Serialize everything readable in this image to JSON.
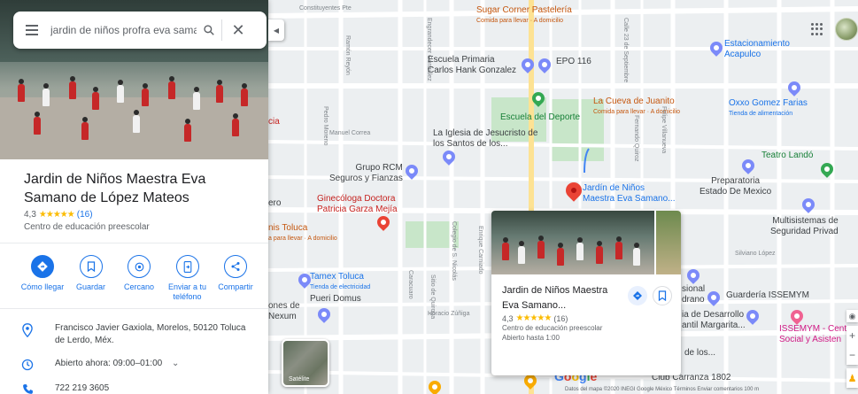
{
  "search": {
    "query": "jardin de niños profra eva samano"
  },
  "place": {
    "title": "Jardin de Niños Maestra Eva Samano de López Mateos",
    "rating": "4,3",
    "stars": "★★★★★",
    "reviews": "(16)",
    "category": "Centro de educación preescolar",
    "address": "Francisco Javier Gaxiola, Morelos, 50120 Toluca de Lerdo, Méx.",
    "hours": "Abierto ahora:  09:00–01:00",
    "phone": "722 219 3605"
  },
  "actions": [
    {
      "label": "Cómo llegar",
      "icon": "directions-icon"
    },
    {
      "label": "Guardar",
      "icon": "bookmark-icon"
    },
    {
      "label": "Cercano",
      "icon": "nearby-icon"
    },
    {
      "label": "Enviar a tu teléfono",
      "icon": "send-to-phone-icon"
    },
    {
      "label": "Compartir",
      "icon": "share-icon"
    }
  ],
  "card": {
    "title": "Jardin de Niños Maestra Eva Samano...",
    "rating": "4,3",
    "stars": "★★★★★",
    "reviews": "(16)",
    "category": "Centro de educación preescolar",
    "hours": "Abierto hasta 1:00"
  },
  "map": {
    "satellite_label": "Satélite",
    "google": "Google",
    "attribution": "Datos del mapa ©2020 INEGI  Google   México   Términos   Enviar comentarios   100 m",
    "labels": {
      "constituyentes_pte": "Constituyentes Pte",
      "sugar_corner": "Sugar Corner Pastelería",
      "sugar_corner_sub": "Comida para llevar · A domicilio",
      "escuela_primaria": "Escuela Primaria",
      "carlos_hank": "Carlos Hank Gonzalez",
      "epo116": "EPO 116",
      "estacionamiento": "Estacionamiento",
      "acapulco": "Acapulco",
      "cueva_juanito": "La Cueva de Juanito",
      "cueva_sub": "Comida para llevar · A domicilio",
      "escuela_deporte": "Escuela del Deporte",
      "oxxo": "Oxxo Gomez Farias",
      "oxxo_sub": "Tienda de alimentación",
      "iglesia": "La Iglesia de Jesucristo de los Santos de los...",
      "manuel_correa": "Manuel Correa",
      "grupo_rcm": "Grupo RCM",
      "seguros": "Seguros y Fianzas",
      "teatro": "Teatro Landó",
      "preparatoria": "Preparatoria",
      "estado_mexico": "Estado De Mexico",
      "ginecologa": "Ginecóloga Doctora",
      "patricia": "Patricia Garza Mejía",
      "jardin_map": "Jardín de Niños",
      "jardin_map2": "Maestra Eva Samano...",
      "multisistemas": "Multisistemas de",
      "seguridad": "Seguridad Privad",
      "silviano": "Silviano López",
      "tamex": "Tamex Toluca",
      "tamex_sub": "Tienda de electricidad",
      "pueri": "Pueri Domus",
      "horacio": "Horacio Zúñiga",
      "guarderia": "Guardería ISSEMYM",
      "desarrollo": "ia de Desarrollo",
      "margarita": "antil Margarita...",
      "issemym": "ISSEMYM - Centr",
      "social": "Social y Asisten",
      "club": "Club Carranza 1802",
      "nexum": "ones de Nexum",
      "toluca_frag": "nis Toluca",
      "toluca_sub": "a para llevar · A domicilio",
      "cia": "cia",
      "ero": "ero",
      "sional": "sional",
      "drano": "drano",
      "de_los": "de los...",
      "felipe": "Felipe Villanueva",
      "colegio": "Colegio de S. Nicolás",
      "enrique": "Enrique Carniado",
      "pedro": "Pedro Moreno",
      "ramon": "Ramón Reyón",
      "calle23": "Calle 23 de Septiembre",
      "fernando": "Fernando Quiroz",
      "carlos_pacheco": "Caracuaro",
      "sitio": "Sitio de Quiroga",
      "engrandecer": "Engrandecer Gonzalez"
    }
  }
}
